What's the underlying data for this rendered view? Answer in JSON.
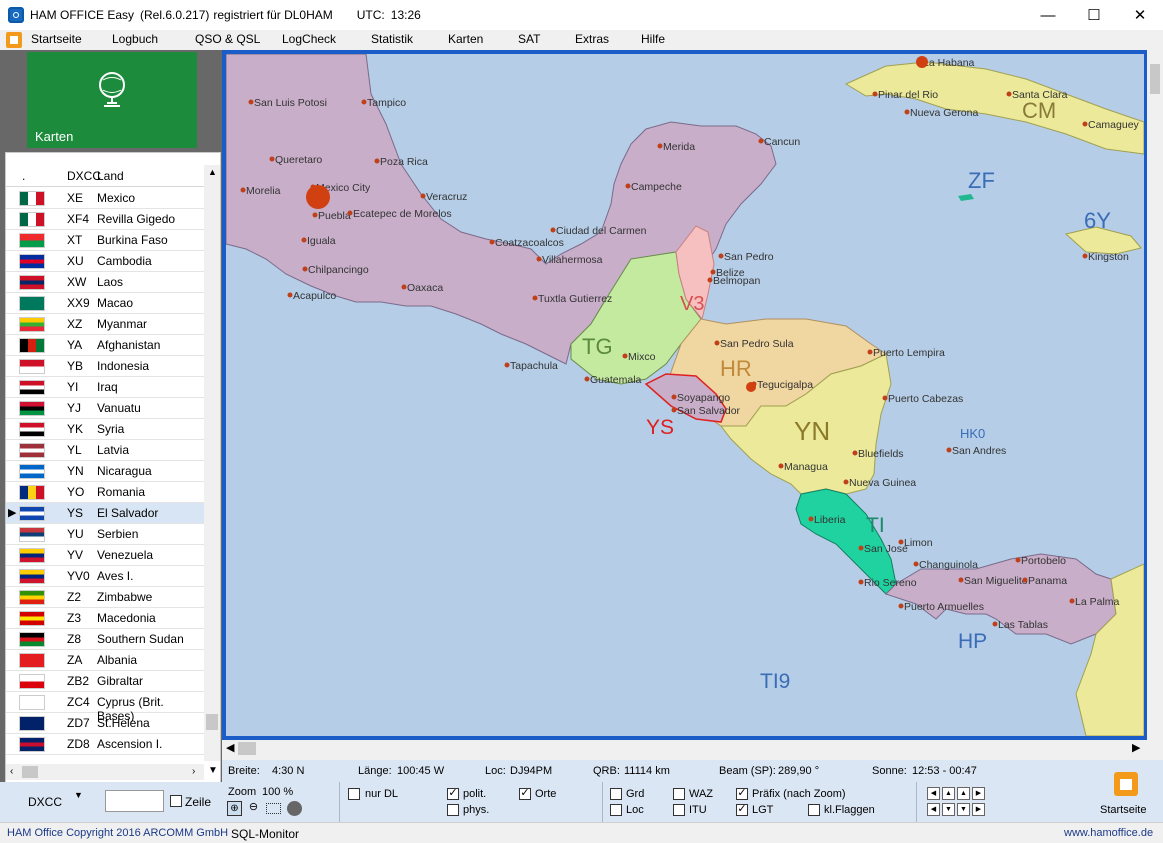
{
  "titlebar": {
    "app_name": "HAM OFFICE Easy",
    "version": "(Rel.6.0.217)",
    "registration": "registriert für DL0HAM",
    "utc_label": "UTC:",
    "utc_time": "13:26"
  },
  "window_controls": {
    "minimize": "—",
    "maximize": "☐",
    "close": "✕"
  },
  "menu": [
    "Startseite",
    "Logbuch",
    "QSO & QSL",
    "LogCheck",
    "Statistik",
    "Karten",
    "SAT",
    "Extras",
    "Hilfe"
  ],
  "sidebar": {
    "tile_label": "Karten"
  },
  "list": {
    "header_dot": ".",
    "header_code": "DXCC",
    "header_land": "Land",
    "rows": [
      {
        "code": "XE",
        "land": "Mexico",
        "flag": [
          "#006847",
          "#ffffff",
          "#ce1126"
        ],
        "orient": "v"
      },
      {
        "code": "XF4",
        "land": "Revilla Gigedo",
        "flag": [
          "#006847",
          "#ffffff",
          "#ce1126"
        ],
        "orient": "v"
      },
      {
        "code": "XT",
        "land": "Burkina Faso",
        "flag": [
          "#ef2b2d",
          "#009e49"
        ],
        "orient": "h"
      },
      {
        "code": "XU",
        "land": "Cambodia",
        "flag": [
          "#032ea1",
          "#e00025",
          "#032ea1"
        ],
        "orient": "h"
      },
      {
        "code": "XW",
        "land": "Laos",
        "flag": [
          "#ce1126",
          "#002868",
          "#ce1126"
        ],
        "orient": "h"
      },
      {
        "code": "XX9",
        "land": "Macao",
        "flag": [
          "#00785e",
          "#00785e"
        ],
        "orient": "h"
      },
      {
        "code": "XZ",
        "land": "Myanmar",
        "flag": [
          "#fecb00",
          "#34b233",
          "#ea2839"
        ],
        "orient": "h"
      },
      {
        "code": "YA",
        "land": "Afghanistan",
        "flag": [
          "#000000",
          "#d32011",
          "#007a36"
        ],
        "orient": "v"
      },
      {
        "code": "YB",
        "land": "Indonesia",
        "flag": [
          "#ce1126",
          "#ffffff"
        ],
        "orient": "h"
      },
      {
        "code": "YI",
        "land": "Iraq",
        "flag": [
          "#ce1126",
          "#ffffff",
          "#000000"
        ],
        "orient": "h"
      },
      {
        "code": "YJ",
        "land": "Vanuatu",
        "flag": [
          "#d21034",
          "#000000",
          "#009543"
        ],
        "orient": "h"
      },
      {
        "code": "YK",
        "land": "Syria",
        "flag": [
          "#ce1126",
          "#ffffff",
          "#000000"
        ],
        "orient": "h"
      },
      {
        "code": "YL",
        "land": "Latvia",
        "flag": [
          "#9e3039",
          "#ffffff",
          "#9e3039"
        ],
        "orient": "h"
      },
      {
        "code": "YN",
        "land": "Nicaragua",
        "flag": [
          "#0067c6",
          "#ffffff",
          "#0067c6"
        ],
        "orient": "h"
      },
      {
        "code": "YO",
        "land": "Romania",
        "flag": [
          "#002b7f",
          "#fcd116",
          "#ce1126"
        ],
        "orient": "v"
      },
      {
        "code": "YS",
        "land": "El Salvador",
        "flag": [
          "#0f47af",
          "#ffffff",
          "#0f47af"
        ],
        "orient": "h"
      },
      {
        "code": "YU",
        "land": "Serbien",
        "flag": [
          "#c6363c",
          "#0c4076",
          "#ffffff"
        ],
        "orient": "h"
      },
      {
        "code": "YV",
        "land": "Venezuela",
        "flag": [
          "#ffcc00",
          "#00247d",
          "#cf142b"
        ],
        "orient": "h"
      },
      {
        "code": "YV0",
        "land": "Aves I.",
        "flag": [
          "#ffcc00",
          "#00247d",
          "#cf142b"
        ],
        "orient": "h"
      },
      {
        "code": "Z2",
        "land": "Zimbabwe",
        "flag": [
          "#319208",
          "#ffd200",
          "#de2010"
        ],
        "orient": "h"
      },
      {
        "code": "Z3",
        "land": "Macedonia",
        "flag": [
          "#d20000",
          "#ffe600",
          "#d20000"
        ],
        "orient": "h"
      },
      {
        "code": "Z8",
        "land": "Southern Sudan",
        "flag": [
          "#000000",
          "#da121a",
          "#078930"
        ],
        "orient": "h"
      },
      {
        "code": "ZA",
        "land": "Albania",
        "flag": [
          "#e41e20",
          "#e41e20"
        ],
        "orient": "h"
      },
      {
        "code": "ZB2",
        "land": "Gibraltar",
        "flag": [
          "#ffffff",
          "#da000c"
        ],
        "orient": "h"
      },
      {
        "code": "ZC4",
        "land": "Cyprus (Brit. Bases)",
        "flag": [
          "#ffffff",
          "#ffffff"
        ],
        "orient": "h"
      },
      {
        "code": "ZD7",
        "land": "St.Helena",
        "flag": [
          "#012169",
          "#012169"
        ],
        "orient": "h"
      },
      {
        "code": "ZD8",
        "land": "Ascension I.",
        "flag": [
          "#012169",
          "#c8102e",
          "#012169"
        ],
        "orient": "h"
      }
    ],
    "selected_index": 15
  },
  "sidebar_bottom": {
    "dxcc_label": "DXCC",
    "zeile_label": "Zeile",
    "search_value": ""
  },
  "map": {
    "prefixes": [
      {
        "text": "CM",
        "color": "#8a7a3a"
      },
      {
        "text": "ZF",
        "color": "#3a6cb8"
      },
      {
        "text": "6Y",
        "color": "#3a6cb8"
      },
      {
        "text": "V3",
        "color": "#d85050"
      },
      {
        "text": "TG",
        "color": "#5a8a3a"
      },
      {
        "text": "HR",
        "color": "#c08a3a"
      },
      {
        "text": "YS",
        "color": "#e02020"
      },
      {
        "text": "YN",
        "color": "#8a7a2a"
      },
      {
        "text": "TI",
        "color": "#1a8a6a"
      },
      {
        "text": "HP",
        "color": "#3a6cb8"
      },
      {
        "text": "HK0",
        "color": "#3a6cb8"
      },
      {
        "text": "TI9",
        "color": "#3a6cb8"
      }
    ],
    "cities": [
      "La Habana",
      "Pinar del Rio",
      "Santa Clara",
      "Nueva Gerona",
      "Camaguey",
      "San Luis Potosi",
      "Tampico",
      "Queretaro",
      "Poza Rica",
      "Morelia",
      "Mexico City",
      "Veracruz",
      "Puebla",
      "Ecatepec de Morelos",
      "Iguala",
      "Chilpancingo",
      "Acapulco",
      "Oaxaca",
      "Merida",
      "Cancun",
      "Campeche",
      "Ciudad del Carmen",
      "Coatzacoalcos",
      "Villahermosa",
      "San Pedro",
      "Belize",
      "Belmopan",
      "Kingston",
      "Tuxtla Gutierrez",
      "Tapachula",
      "Mixco",
      "Guatemala",
      "San Pedro Sula",
      "Puerto Lempira",
      "Tegucigalpa",
      "Soyapango",
      "San Salvador",
      "Puerto Cabezas",
      "San Andres",
      "Managua",
      "Bluefields",
      "Nueva Guinea",
      "Liberia",
      "Limon",
      "San Jose",
      "Changuinola",
      "Portobelo",
      "Rio Sereno",
      "San Miguelito",
      "Panama",
      "La Palma",
      "Puerto Armuelles",
      "Las Tablas"
    ]
  },
  "infobar": {
    "breite_label": "Breite:",
    "breite": "4:30 N",
    "laenge_label": "Länge:",
    "laenge": "100:45 W",
    "loc_label": "Loc:",
    "loc": "DJ94PM",
    "qrb_label": "QRB:",
    "qrb": "11114 km",
    "beam_label": "Beam (SP):",
    "beam": "289,90 °",
    "sonne_label": "Sonne:",
    "sonne": "12:53 - 00:47"
  },
  "controls": {
    "zoom_label": "Zoom",
    "zoom_value": "100 %",
    "nur_dl": "nur DL",
    "polit": "polit.",
    "phys": "phys.",
    "orte": "Orte",
    "grd": "Grd",
    "loc": "Loc",
    "waz": "WAZ",
    "itu": "ITU",
    "praefix": "Präfix (nach Zoom)",
    "lgt": "LGT",
    "kl_flaggen": "kl.Flaggen",
    "startseite": "Startseite",
    "checked": {
      "nur_dl": false,
      "polit": true,
      "phys": false,
      "orte": true,
      "grd": false,
      "loc": false,
      "waz": false,
      "itu": false,
      "praefix": true,
      "lgt": true,
      "kl_flaggen": false
    }
  },
  "statusbar": {
    "copyright": "HAM Office Copyright 2016 ARCOMM GmbH",
    "sql": "SQL-Monitor",
    "website": "www.hamoffice.de"
  },
  "colors": {
    "accent_green": "#1c8c3c",
    "map_border": "#1a5cc8",
    "sea": "#b5cde6"
  }
}
